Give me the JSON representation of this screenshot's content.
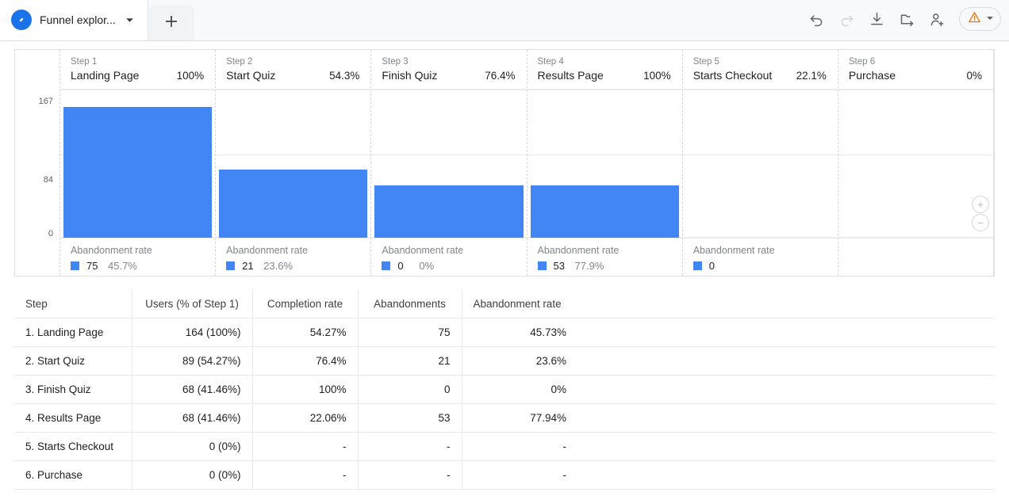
{
  "tab": {
    "title": "Funnel explor...",
    "logo_icon": "ga-compass-icon",
    "caret_icon": "chevron-down-icon",
    "new_tab_icon": "plus-icon",
    "new_tab_label": "+"
  },
  "toolbar": {
    "buttons": [
      {
        "name": "undo-button",
        "icon": "undo-icon",
        "disabled": false
      },
      {
        "name": "redo-button",
        "icon": "redo-icon",
        "disabled": true
      },
      {
        "name": "download-button",
        "icon": "download-icon",
        "disabled": false
      },
      {
        "name": "export-button",
        "icon": "folder-export-icon",
        "disabled": false
      },
      {
        "name": "share-button",
        "icon": "add-person-icon",
        "disabled": false
      }
    ],
    "warning_chip": {
      "icon": "warning-triangle-icon",
      "caret_icon": "chevron-down-icon",
      "color": "#e8710a"
    }
  },
  "funnel": {
    "accent_color": "#4285f4",
    "y_axis": {
      "ticks": [
        "167",
        "84",
        "0"
      ],
      "max": 167,
      "min": 0
    },
    "zoom_controls": {
      "zoom_in_label": "+",
      "zoom_out_label": "−"
    },
    "footer_title": "Abandonment rate",
    "steps": [
      {
        "step_label": "Step 1",
        "name": "Landing Page",
        "percent": "100%",
        "users": 164,
        "abandonments": "75",
        "abandon_pct": "45.7%",
        "has_bar": true,
        "has_footer": true
      },
      {
        "step_label": "Step 2",
        "name": "Start Quiz",
        "percent": "54.3%",
        "users": 89,
        "abandonments": "21",
        "abandon_pct": "23.6%",
        "has_bar": true,
        "has_footer": true
      },
      {
        "step_label": "Step 3",
        "name": "Finish Quiz",
        "percent": "76.4%",
        "users": 68,
        "abandonments": "0",
        "abandon_pct": "0%",
        "has_bar": true,
        "has_footer": true
      },
      {
        "step_label": "Step 4",
        "name": "Results Page",
        "percent": "100%",
        "users": 68,
        "abandonments": "53",
        "abandon_pct": "77.9%",
        "has_bar": true,
        "has_footer": true
      },
      {
        "step_label": "Step 5",
        "name": "Starts Checkout",
        "percent": "22.1%",
        "users": 0,
        "abandonments": "0",
        "abandon_pct": "",
        "has_bar": false,
        "has_footer": true
      },
      {
        "step_label": "Step 6",
        "name": "Purchase",
        "percent": "0%",
        "users": 0,
        "abandonments": "",
        "abandon_pct": "",
        "has_bar": false,
        "has_footer": false
      }
    ]
  },
  "table": {
    "headers": [
      "Step",
      "Users (% of Step 1)",
      "Completion rate",
      "Abandonments",
      "Abandonment rate"
    ],
    "rows": [
      [
        "1. Landing Page",
        "164 (100%)",
        "54.27%",
        "75",
        "45.73%"
      ],
      [
        "2. Start Quiz",
        "89 (54.27%)",
        "76.4%",
        "21",
        "23.6%"
      ],
      [
        "3. Finish Quiz",
        "68 (41.46%)",
        "100%",
        "0",
        "0%"
      ],
      [
        "4. Results Page",
        "68 (41.46%)",
        "22.06%",
        "53",
        "77.94%"
      ],
      [
        "5. Starts Checkout",
        "0 (0%)",
        "-",
        "-",
        "-"
      ],
      [
        "6. Purchase",
        "0 (0%)",
        "-",
        "-",
        "-"
      ]
    ]
  },
  "chart_data": {
    "type": "bar",
    "title": "Funnel exploration",
    "categories": [
      "Landing Page",
      "Start Quiz",
      "Finish Quiz",
      "Results Page",
      "Starts Checkout",
      "Purchase"
    ],
    "series": [
      {
        "name": "Users",
        "values": [
          164,
          89,
          68,
          68,
          0,
          0
        ]
      },
      {
        "name": "Abandonments",
        "values": [
          75,
          21,
          0,
          53,
          0,
          null
        ]
      }
    ],
    "completion_rate": [
      "54.27%",
      "76.4%",
      "100%",
      "22.06%",
      "-",
      "-"
    ],
    "abandonment_rate": [
      "45.73%",
      "23.6%",
      "0%",
      "77.94%",
      "-",
      "-"
    ],
    "step_percent_of_previous": [
      "100%",
      "54.3%",
      "76.4%",
      "100%",
      "22.1%",
      "0%"
    ],
    "percent_of_step1": [
      "100%",
      "54.27%",
      "41.46%",
      "41.46%",
      "0%",
      "0%"
    ],
    "xlabel": "",
    "ylabel": "",
    "ylim": [
      0,
      167
    ],
    "yticks": [
      0,
      84,
      167
    ],
    "grid": true,
    "legend": "none"
  }
}
